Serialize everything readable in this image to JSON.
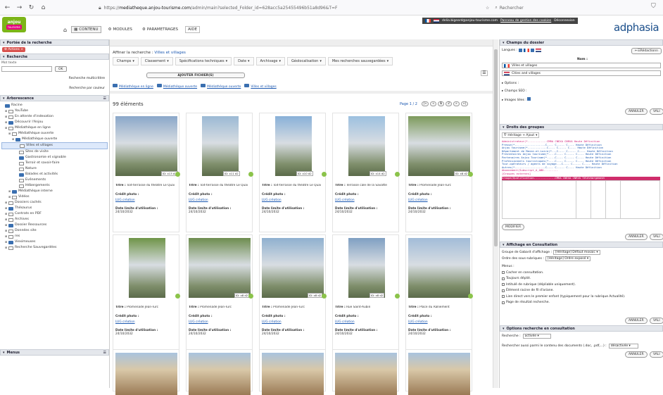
{
  "browser": {
    "url_scheme": "https://",
    "url_host": "mediatheque.anjou-tourisme.com",
    "url_path": "/admin/main?selected_Folder_id=628acc5a25455496b51a8d96&T=F",
    "search_placeholder": "Rechercher"
  },
  "app": {
    "logo_text": "anjou",
    "logo_tag": "tourisme",
    "brand": "adphasia",
    "menu": [
      {
        "label": "CONTENU"
      },
      {
        "label": "MODULES"
      },
      {
        "label": "PARAMETRAGES"
      },
      {
        "label": "AIDE"
      }
    ],
    "user_email": "delia.bigeard@anjou-tourisme.com",
    "cookie_link": "Panneau de gestion des cookies",
    "logout": "Déconnexion"
  },
  "left": {
    "portee_title": "Portée de la recherche",
    "actions_label": "Actions",
    "recherche_title": "Recherche",
    "search_label": "Mot texte",
    "ok_label": "OK",
    "multi_label": "Recherche multicritère",
    "color_label": "Recherche par couleur",
    "arbo_title": "Arborescence",
    "tree": [
      {
        "label": "Racine",
        "indent": 0,
        "selected": false
      },
      {
        "label": "YouTube",
        "indent": 1,
        "selected": false
      },
      {
        "label": "En attente d'indexation",
        "indent": 1,
        "selected": false
      },
      {
        "label": "Découvrir l'Anjou",
        "indent": 1,
        "selected": false
      },
      {
        "label": "Médiathèque en ligne",
        "indent": 1,
        "selected": false
      },
      {
        "label": "Médiathèque ouverte",
        "indent": 2,
        "selected": false
      },
      {
        "label": "Médiathèque ouverte",
        "indent": 3,
        "selected": false
      },
      {
        "label": "Villes et villages",
        "indent": 4,
        "selected": true
      },
      {
        "label": "Sites de visite",
        "indent": 4,
        "selected": false
      },
      {
        "label": "Gastronomie et vignoble",
        "indent": 4,
        "selected": false
      },
      {
        "label": "Terroir et savoir-faire",
        "indent": 4,
        "selected": false
      },
      {
        "label": "Nature",
        "indent": 4,
        "selected": false
      },
      {
        "label": "Balades et activités",
        "indent": 4,
        "selected": false
      },
      {
        "label": "Evénements",
        "indent": 4,
        "selected": false
      },
      {
        "label": "Hébergements",
        "indent": 4,
        "selected": false
      },
      {
        "label": "Médiathèque interne",
        "indent": 2,
        "selected": false
      },
      {
        "label": "Vidéos",
        "indent": 2,
        "selected": false
      },
      {
        "label": "Dossiers cachés",
        "indent": 1,
        "selected": false
      },
      {
        "label": "Thésaurus",
        "indent": 1,
        "selected": false
      },
      {
        "label": "Contrats en PDF",
        "indent": 1,
        "selected": false
      },
      {
        "label": "Archives",
        "indent": 1,
        "selected": false
      },
      {
        "label": "Dossier Ressources",
        "indent": 1,
        "selected": false
      },
      {
        "label": "Données site",
        "indent": 1,
        "selected": false
      },
      {
        "label": "res",
        "indent": 1,
        "selected": false
      },
      {
        "label": "Vieximeuses",
        "indent": 1,
        "selected": false
      },
      {
        "label": "Recherche Sauvegardées",
        "indent": 1,
        "selected": false
      }
    ],
    "menus_title": "Menus"
  },
  "center": {
    "refine_label": "Affiner la recherche :",
    "refine_value": "Villes et villages",
    "tabs": [
      {
        "label": "Champs"
      },
      {
        "label": "Classement"
      },
      {
        "label": "Spécifications techniques"
      },
      {
        "label": "Date"
      },
      {
        "label": "Archivage"
      },
      {
        "label": "Géolocalisation"
      },
      {
        "label": "Mes recherches sauvegardées"
      }
    ],
    "add_files": "AJOUTER FICHIER(S)",
    "breadcrumb": [
      "Médiathèque en ligne",
      "Médiathèque ouverte",
      "Médiathèque ouverte",
      "Villes et villages"
    ],
    "count_label": "99 éléments",
    "page_label": "Page 1 / 2",
    "pages": [
      "1",
      "2"
    ],
    "field_title": "Titre :",
    "field_credit": "Crédit photo :",
    "field_date": "Date limite d'utilisation :",
    "cards": [
      {
        "title": "Toit-terrasse du théâtre Le Quai",
        "credit": "LUG création",
        "date": "24/10/2032",
        "chip": "ID: x13 d2",
        "hue": "#8aa7c9"
      },
      {
        "title": "Toit-terrasse du théâtre Le Quai",
        "credit": "LUG création",
        "date": "24/10/2032",
        "chip": "ID: x11 d2",
        "hue": "#9bb9d4"
      },
      {
        "title": "Toit-terrasse du théâtre Le Quai",
        "credit": "LUG création",
        "date": "24/10/2032",
        "chip": "ID: x10 d2",
        "hue": "#88b0d8"
      },
      {
        "title": "Terrasse cale de la Savatte",
        "credit": "LUG création",
        "date": "24/10/2032",
        "chip": "ID: x14 d2",
        "hue": "#9cc0e0"
      },
      {
        "title": "Promenade Jean-Turc",
        "credit": "LUG création",
        "date": "24/10/2032",
        "chip": "ID: x8 d2",
        "hue": "#7d9a5c"
      },
      {
        "title": "Promenade Jean-Turc",
        "credit": "LUG création",
        "date": "24/10/2032",
        "chip": "",
        "hue": "#6f9448"
      },
      {
        "title": "Promenade Jean-Turc",
        "credit": "LUG création",
        "date": "24/10/2032",
        "chip": "ID: x8 d2",
        "hue": "#6d8c4e"
      },
      {
        "title": "Promenade Jean-Turc",
        "credit": "LUG création",
        "date": "24/10/2032",
        "chip": "ID: x8 d2",
        "hue": "#8fb0cf"
      },
      {
        "title": "Rue Saint-Aubin",
        "credit": "LUG création",
        "date": "24/10/2032",
        "chip": "ID: x8 d2",
        "hue": "#7f9fc2"
      },
      {
        "title": "Place du Ralliement",
        "credit": "LUG création",
        "date": "24/10/2032",
        "chip": "",
        "hue": "#a2bcd8"
      }
    ]
  },
  "right": {
    "champs_title": "Champs du dossier",
    "langues_label": "Langues :",
    "redact_label": "Rédactionn",
    "nom_label": "Nom :",
    "nom_fr": "Villes et villages",
    "nom_en": "Cities and villages",
    "options_label": "Options :",
    "seo_label": "Champs SEO :",
    "images_label": "Images liées :",
    "annuler": "ANNULER",
    "valider": "VALI",
    "droits_title": "Droits des groupes",
    "heritage_label": "Héritage + Ajout",
    "groups": [
      "Administrateur(*............CMRA CNEXA CNRVA Haute Définition",
      "Presse(*...................C---- C----- C---- Haute Définition",
      "Anjou tourisme(*............C---- C----- C---- Haute Définition",
      "Département de Maine-et-Loire(*...C---- C----- C---- Haute Définition",
      "Prestataires Anjou tourisme(*....C---- C----- C---- Haute Définition",
      "Partenaires Anjou Tourisme(*.....C---- C----- C---- Haute Définition",
      "Professionnels touristiques(*....C---- C----- C---- Haute Définition",
      "Tour-opérateurs / agents de voyage...C---- C----- C---- Haute Définition",
      "Autres(*...................C---- C----- C---- Haute Définition",
      "Abonnement(Subscript_A_ABO.........",
      "[Groupes externes]"
    ],
    "group_header": "Groupe/Qualification.............CMRA CNEXA CNRVA Téléchargement",
    "modifier": "MODIFIER",
    "affichage_title": "Affichage en Consultation",
    "gabarit_label": "Groupe de Gabarit d'affichage :",
    "gabarit_value": "[Héritage] Défaut mosaic",
    "ordre_label": "Ordre des sous-rubriques :",
    "ordre_value": "[Héritage] Ordre exposé",
    "menus_label": "Menus :",
    "checks": [
      "Cacher en consultation.",
      "Toujours déplié.",
      "Intitulé de rubrique (dépliable uniquement).",
      "Élément racine de fil d'ariane.",
      "Lien direct vers le premier enfant (typiquement pour la rubrique Actualité).",
      "Page de résultat recherche."
    ],
    "options_title": "Options recherche en consultation",
    "recherche_label": "Recherche :",
    "recherche_value": "activée",
    "doc_label": "Rechercher aussi parmi le contenu des documents (.doc, .pdf,...) :",
    "doc_value": "désactivée"
  }
}
